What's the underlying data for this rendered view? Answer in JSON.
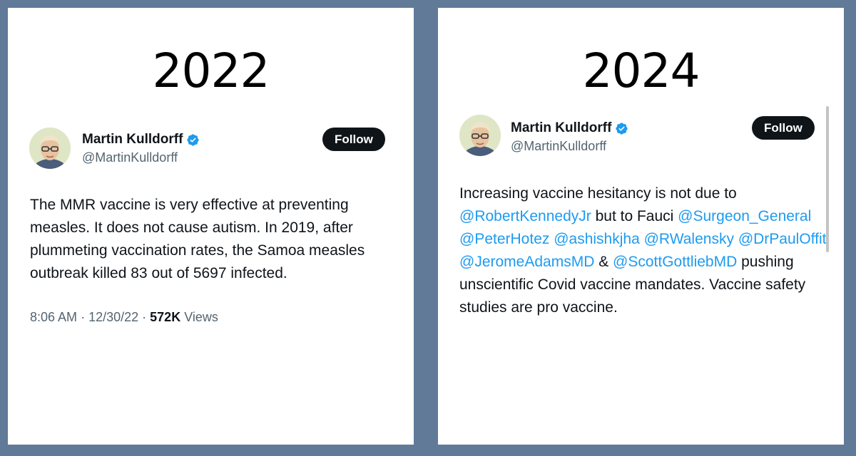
{
  "panels": [
    {
      "year": "2022",
      "author": {
        "name": "Martin Kulldorff",
        "handle": "@MartinKulldorff"
      },
      "follow_label": "Follow",
      "tweet_text": "The MMR vaccine is very effective at preventing measles. It does not cause autism. In 2019, after plummeting vaccination rates, the Samoa measles outbreak killed 83 out of 5697 infected.",
      "meta": {
        "time": "8:06 AM",
        "date": "12/30/22",
        "views_count": "572K",
        "views_label": "Views"
      }
    },
    {
      "year": "2024",
      "author": {
        "name": "Martin Kulldorff",
        "handle": "@MartinKulldorff"
      },
      "follow_label": "Follow",
      "tweet_segments": [
        {
          "text": "Increasing vaccine hesitancy is not due to ",
          "mention": false
        },
        {
          "text": "@RobertKennedyJr",
          "mention": true
        },
        {
          "text": " but to Fauci ",
          "mention": false
        },
        {
          "text": "@Surgeon_General",
          "mention": true
        },
        {
          "text": " ",
          "mention": false
        },
        {
          "text": "@PeterHotez",
          "mention": true
        },
        {
          "text": " ",
          "mention": false
        },
        {
          "text": "@ashishkjha",
          "mention": true
        },
        {
          "text": " ",
          "mention": false
        },
        {
          "text": "@RWalensky",
          "mention": true
        },
        {
          "text": " ",
          "mention": false
        },
        {
          "text": "@DrPaulOffit",
          "mention": true
        },
        {
          "text": " ",
          "mention": false
        },
        {
          "text": "@JeromeAdamsMD",
          "mention": true
        },
        {
          "text": " & ",
          "mention": false
        },
        {
          "text": "@ScottGottliebMD",
          "mention": true
        },
        {
          "text": " pushing unscientific Covid vaccine mandates. Vaccine safety studies are pro vaccine.",
          "mention": false
        }
      ]
    }
  ],
  "colors": {
    "background": "#607a98",
    "mention": "#1d9bf0",
    "verified": "#1d9bf0",
    "follow_button": "#0f1419"
  }
}
